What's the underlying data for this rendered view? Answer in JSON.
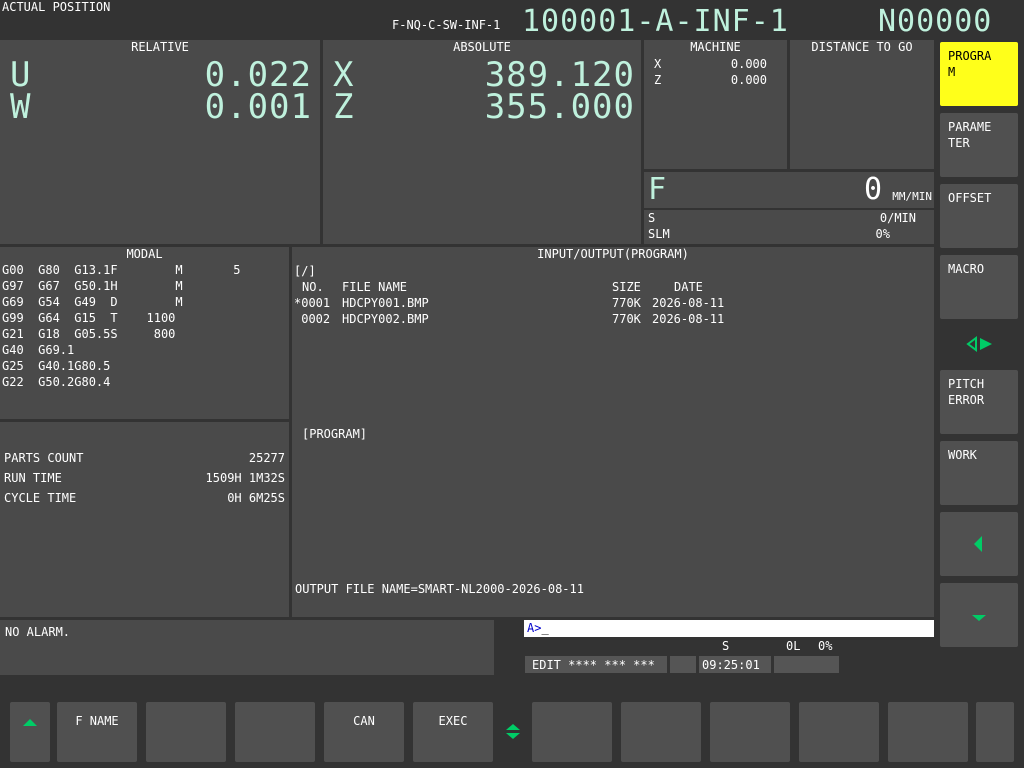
{
  "header": {
    "screen_title": "ACTUAL POSITION",
    "small_program": "F-NQ-C-SW-INF-1",
    "program_name": "100001-A-INF-1",
    "sequence": "N00000"
  },
  "relative": {
    "title": "RELATIVE",
    "axes": [
      {
        "name": "U",
        "value": "0.022"
      },
      {
        "name": "W",
        "value": "0.001"
      }
    ]
  },
  "absolute": {
    "title": "ABSOLUTE",
    "axes": [
      {
        "name": "X",
        "value": "389.120"
      },
      {
        "name": "Z",
        "value": "355.000"
      }
    ]
  },
  "machine": {
    "title": "MACHINE",
    "axes": [
      {
        "name": "X",
        "value": "0.000"
      },
      {
        "name": "Z",
        "value": "0.000"
      }
    ]
  },
  "distance": {
    "title": "DISTANCE TO GO"
  },
  "feed": {
    "label": "F",
    "value": "0",
    "unit": "MM/MIN",
    "s_label": "S",
    "s_value": "0/MIN",
    "slm_label": "SLM",
    "slm_value": "0%"
  },
  "modal": {
    "title": "MODAL",
    "rows": [
      "G00  G80  G13.1F        M       5",
      "G97  G67  G50.1H        M",
      "G69  G54  G49  D        M",
      "G99  G64  G15  T    1100",
      "G21  G18  G05.5S     800",
      "G40  G69.1",
      "G25  G40.1G80.5",
      "G22  G50.2G80.4"
    ]
  },
  "counts": {
    "parts_label": "PARTS COUNT",
    "parts_value": "25277",
    "run_label": "RUN TIME",
    "run_value": "1509H 1M32S",
    "cycle_label": "CYCLE TIME",
    "cycle_value": "0H 6M25S"
  },
  "io": {
    "title": "INPUT/OUTPUT(PROGRAM)",
    "path": "[/]",
    "headers": {
      "no": "NO.",
      "name": "FILE NAME",
      "size": "SIZE",
      "date": "DATE"
    },
    "files": [
      {
        "no": "*0001",
        "name": "HDCPY001.BMP",
        "size": "770K",
        "date": "2026-08-11"
      },
      {
        "no": " 0002",
        "name": "HDCPY002.BMP",
        "size": "770K",
        "date": "2026-08-11"
      }
    ],
    "program_label": "[PROGRAM]",
    "output_line": "OUTPUT FILE NAME=SMART-NL2000-2026-08-11"
  },
  "alarm": {
    "text": "NO ALARM."
  },
  "input": {
    "prompt": "A>",
    "value": "_"
  },
  "status": {
    "s_label": "S",
    "s_value": "0L",
    "s_percent": "0%",
    "mode": "EDIT **** *** ***",
    "time": "09:25:01"
  },
  "right_softkeys": [
    {
      "label": "PROGRA\nM",
      "active": true
    },
    {
      "label": "PARAME\nTER",
      "active": false
    },
    {
      "label": "OFFSET",
      "active": false
    },
    {
      "label": "MACRO",
      "active": false
    },
    {
      "label": "PITCH\nERROR",
      "active": false
    },
    {
      "label": "WORK",
      "active": false
    }
  ],
  "bottom_softkeys": [
    {
      "label": "F NAME"
    },
    {
      "label": ""
    },
    {
      "label": ""
    },
    {
      "label": "CAN"
    },
    {
      "label": "EXEC"
    },
    {
      "label": ""
    },
    {
      "label": ""
    },
    {
      "label": ""
    },
    {
      "label": ""
    },
    {
      "label": ""
    },
    {
      "label": ""
    }
  ],
  "colors": {
    "accent": "#bff1dd",
    "active_key": "#ffff1a",
    "nav_arrow": "#00cc66"
  },
  "icons": {
    "up": "triangle-up-icon",
    "left": "triangle-left-icon",
    "down": "triangle-down-icon",
    "toggle": "diamond-toggle-icon",
    "page": "double-chevron-icon"
  }
}
